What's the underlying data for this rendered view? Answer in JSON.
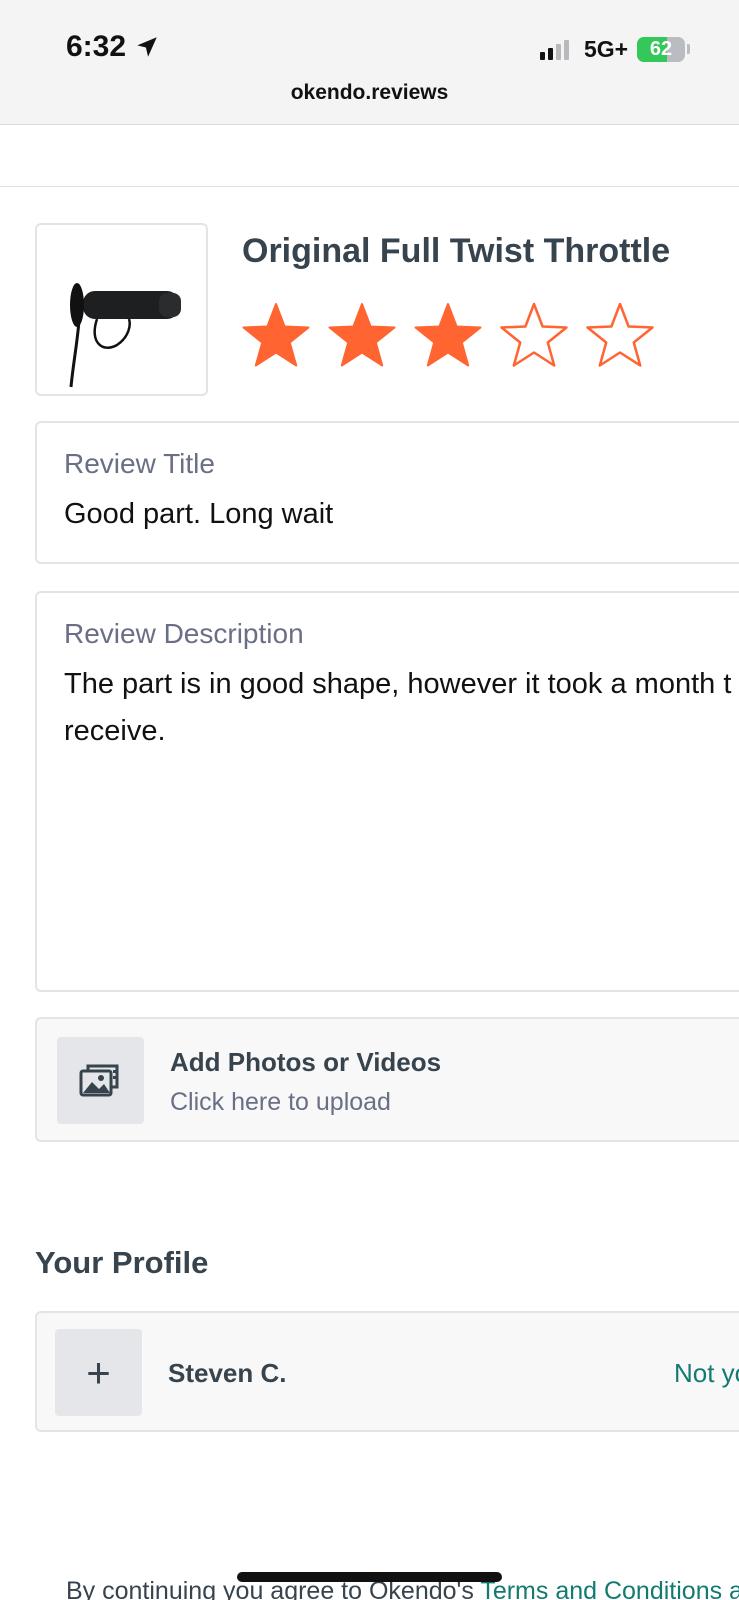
{
  "status_bar": {
    "time": "6:32",
    "network": "5G+",
    "battery_percent": "62",
    "battery_level": 0.62,
    "signal_bars_active": 2,
    "signal_bars_total": 4,
    "battery_color": "#34c759"
  },
  "browser": {
    "url": "okendo.reviews"
  },
  "product": {
    "title": "Original Full Twist Throttle",
    "rating": 3,
    "max_rating": 5,
    "star_color": "#ff6431",
    "image_icon": "throttle-grip-photo"
  },
  "form": {
    "review_title_label": "Review Title",
    "review_title_value": "Good part. Long wait",
    "review_description_label": "Review Description",
    "review_description_line1": "The part is in good shape, however it took a month t",
    "review_description_line2": "receive."
  },
  "upload": {
    "title": "Add Photos or Videos",
    "subtitle": "Click here to upload",
    "icon": "photo-upload-icon"
  },
  "profile": {
    "heading": "Your Profile",
    "name": "Steven C.",
    "not_you_label": "Not yo",
    "plus_symbol": "+",
    "accent_color": "#137a72"
  },
  "footer": {
    "text_prefix": "By continuing you agree to Okendo's ",
    "terms_link": "Terms and Conditions a"
  }
}
